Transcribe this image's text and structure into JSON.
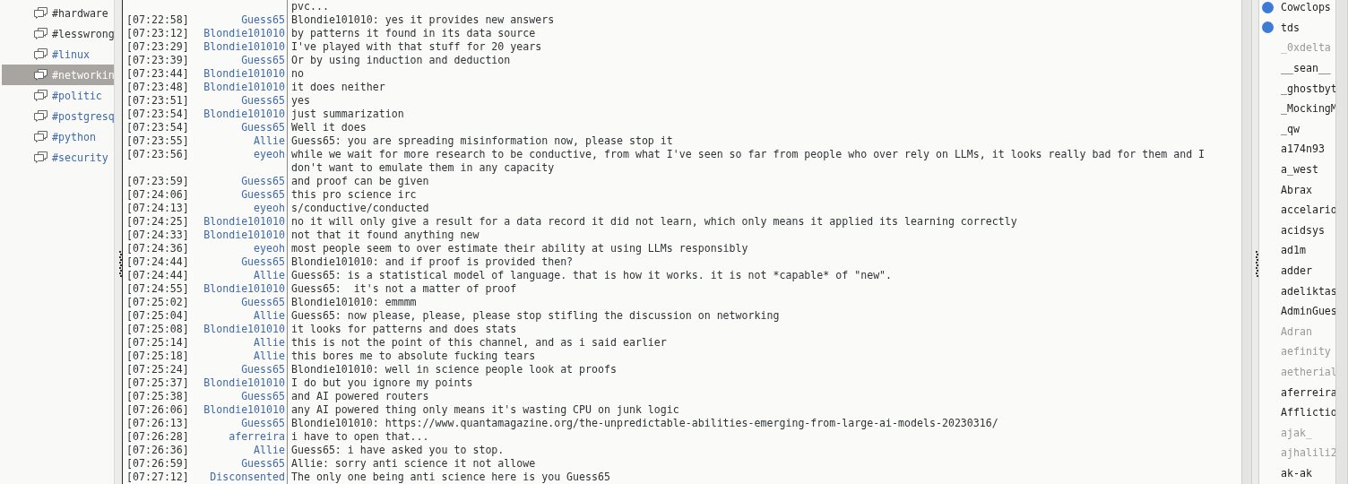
{
  "channels": [
    {
      "name": "#hardware",
      "color": "#2e3436",
      "selected": false
    },
    {
      "name": "#lesswrong",
      "color": "#2e3436",
      "selected": false
    },
    {
      "name": "#linux",
      "color": "#3f6aa8",
      "selected": false
    },
    {
      "name": "#networkin",
      "selected": true
    },
    {
      "name": "#politic",
      "color": "#3f6aa8",
      "selected": false
    },
    {
      "name": "#postgresq",
      "color": "#3f6aa8",
      "selected": false
    },
    {
      "name": "#python",
      "color": "#3f6aa8",
      "selected": false
    },
    {
      "name": "#security",
      "color": "#3f6aa8",
      "selected": false
    }
  ],
  "messages": [
    {
      "text": "pvc..."
    },
    {
      "time": "[07:22:58]",
      "nick": "Guess65",
      "text": "Blondie101010: yes it provides new answers"
    },
    {
      "time": "[07:23:12]",
      "nick": "Blondie101010",
      "text": "by patterns it found in its data source"
    },
    {
      "time": "[07:23:29]",
      "nick": "Blondie101010",
      "text": "I've played with that stuff for 20 years"
    },
    {
      "time": "[07:23:39]",
      "nick": "Guess65",
      "text": "Or by using induction and deduction"
    },
    {
      "time": "[07:23:44]",
      "nick": "Blondie101010",
      "text": "no"
    },
    {
      "time": "[07:23:48]",
      "nick": "Blondie101010",
      "text": "it does neither"
    },
    {
      "time": "[07:23:51]",
      "nick": "Guess65",
      "text": "yes"
    },
    {
      "time": "[07:23:54]",
      "nick": "Blondie101010",
      "text": "just summarization"
    },
    {
      "time": "[07:23:54]",
      "nick": "Guess65",
      "text": "Well it does"
    },
    {
      "time": "[07:23:55]",
      "nick": "Allie",
      "text": "Guess65: you are spreading misinformation now, please stop it"
    },
    {
      "time": "[07:23:56]",
      "nick": "eyeoh",
      "text": "while we wait for more research to be conductive, from what I've seen so far from people who over rely on LLMs, it looks really bad for them and I don't want to emulate them in any capacity"
    },
    {
      "time": "[07:23:59]",
      "nick": "Guess65",
      "text": "and proof can be given"
    },
    {
      "time": "[07:24:06]",
      "nick": "Guess65",
      "text": "this pro science irc"
    },
    {
      "time": "[07:24:13]",
      "nick": "eyeoh",
      "text": "s/conductive/conducted"
    },
    {
      "time": "[07:24:25]",
      "nick": "Blondie101010",
      "text": "no it will only give a result for a data record it did not learn, which only means it applied its learning correctly"
    },
    {
      "time": "[07:24:33]",
      "nick": "Blondie101010",
      "text": "not that it found anything new"
    },
    {
      "time": "[07:24:36]",
      "nick": "eyeoh",
      "text": "most people seem to over estimate their ability at using LLMs responsibly"
    },
    {
      "time": "[07:24:44]",
      "nick": "Guess65",
      "text": "Blondie101010: and if proof is provided then?"
    },
    {
      "time": "[07:24:44]",
      "nick": "Allie",
      "text": "Guess65: is a statistical model of language. that is how it works. it is not *capable* of \"new\"."
    },
    {
      "time": "[07:24:55]",
      "nick": "Blondie101010",
      "text": "Guess65:  it's not a matter of proof"
    },
    {
      "time": "[07:25:02]",
      "nick": "Guess65",
      "text": "Blondie101010: emmmm"
    },
    {
      "time": "[07:25:04]",
      "nick": "Allie",
      "text": "Guess65: now please, please, please stop stifling the discussion on networking"
    },
    {
      "time": "[07:25:08]",
      "nick": "Blondie101010",
      "text": "it looks for patterns and does stats"
    },
    {
      "time": "[07:25:14]",
      "nick": "Allie",
      "text": "this is not the point of this channel, and as i said earlier"
    },
    {
      "time": "[07:25:18]",
      "nick": "Allie",
      "text": "this bores me to absolute fucking tears"
    },
    {
      "time": "[07:25:24]",
      "nick": "Guess65",
      "text": "Blondie101010: well in science people look at proofs"
    },
    {
      "time": "[07:25:37]",
      "nick": "Blondie101010",
      "text": "I do but you ignore my points"
    },
    {
      "time": "[07:25:38]",
      "nick": "Guess65",
      "text": "and AI powered routers"
    },
    {
      "time": "[07:26:06]",
      "nick": "Blondie101010",
      "text": "any AI powered thing only means it's wasting CPU on junk logic"
    },
    {
      "time": "[07:26:13]",
      "nick": "Guess65",
      "text": "Blondie101010: https://www.quantamagazine.org/the-unpredictable-abilities-emerging-from-large-ai-models-20230316/"
    },
    {
      "time": "[07:26:28]",
      "nick": "aferreira",
      "text": "i have to open that..."
    },
    {
      "time": "[07:26:36]",
      "nick": "Allie",
      "text": "Guess65: i have asked you to stop."
    },
    {
      "time": "[07:26:59]",
      "nick": "Guess65",
      "text": "Allie: sorry anti science it not allowe"
    },
    {
      "time": "[07:27:12]",
      "nick": "Disconsented",
      "text": "The only one being anti science here is you Guess65"
    }
  ],
  "users": [
    {
      "name": "Cowclops",
      "op": true,
      "away": false
    },
    {
      "name": "tds",
      "op": true,
      "away": false
    },
    {
      "name": "_0xdelta",
      "op": false,
      "away": true
    },
    {
      "name": "__sean__",
      "op": false,
      "away": false
    },
    {
      "name": "_ghostbyt",
      "op": false,
      "away": false
    },
    {
      "name": "_MockingM",
      "op": false,
      "away": false
    },
    {
      "name": "_qw",
      "op": false,
      "away": false
    },
    {
      "name": "a174n93",
      "op": false,
      "away": false
    },
    {
      "name": "a_west",
      "op": false,
      "away": false
    },
    {
      "name": "Abrax",
      "op": false,
      "away": false
    },
    {
      "name": "accelario",
      "op": false,
      "away": false
    },
    {
      "name": "acidsys",
      "op": false,
      "away": false
    },
    {
      "name": "ad1m",
      "op": false,
      "away": false
    },
    {
      "name": "adder",
      "op": false,
      "away": false
    },
    {
      "name": "adeliktas",
      "op": false,
      "away": false
    },
    {
      "name": "AdminGues",
      "op": false,
      "away": false
    },
    {
      "name": "Adran",
      "op": false,
      "away": true
    },
    {
      "name": "aefinity",
      "op": false,
      "away": true
    },
    {
      "name": "aetherial",
      "op": false,
      "away": true
    },
    {
      "name": "aferreira",
      "op": false,
      "away": false
    },
    {
      "name": "Afflictio",
      "op": false,
      "away": false
    },
    {
      "name": "ajak_",
      "op": false,
      "away": true
    },
    {
      "name": "ajhalili2",
      "op": false,
      "away": true
    },
    {
      "name": "ak-ak",
      "op": false,
      "away": false
    }
  ]
}
